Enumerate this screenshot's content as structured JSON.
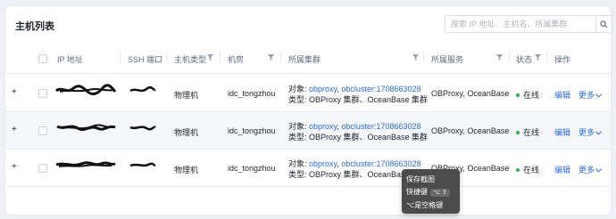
{
  "header": {
    "title": "主机列表",
    "search_placeholder": "搜索 IP 地址、主机名、所属集群"
  },
  "columns": {
    "ip": "IP 地址",
    "ssh": "SSH 端口",
    "host_type": "主机类型",
    "room": "机房",
    "cluster": "所属集群",
    "service": "所属服务",
    "status": "状态",
    "actions": "操作"
  },
  "rows": [
    {
      "expand": "+",
      "host_type": "物理机",
      "room": "idc_tongzhou",
      "cluster_obj_label": "对象:",
      "cluster_obj_1": "obproxy",
      "cluster_obj_sep": ",",
      "cluster_obj_2": "obcluster:1708663028",
      "cluster_type": "类型: OBProxy 集群、OceanBase 集群",
      "service": "OBProxy, OceanBase",
      "status": "在线",
      "edit": "编辑",
      "more": "更多"
    },
    {
      "expand": "+",
      "host_type": "物理机",
      "room": "idc_tongzhou",
      "cluster_obj_label": "对象:",
      "cluster_obj_1": "obproxy",
      "cluster_obj_sep": ",",
      "cluster_obj_2": "obcluster:1708663028",
      "cluster_type": "类型: OBProxy 集群、OceanBase 集群",
      "service": "OBProxy, OceanBase",
      "status": "在线",
      "edit": "编辑",
      "more": "更多"
    },
    {
      "expand": "+",
      "host_type": "物理机",
      "room": "idc_tongzhou",
      "cluster_obj_label": "对象:",
      "cluster_obj_1": "obproxy",
      "cluster_obj_sep": ",",
      "cluster_obj_2": "obcluster:1708663028",
      "cluster_type": "类型: OBProxy 集群、OceanBase 集群",
      "service": "OBProxy, OceanBase",
      "status": "在线",
      "edit": "编辑",
      "more": "更多"
    }
  ],
  "context_menu": {
    "save": "保存截图",
    "shortcut": "快捷键",
    "shortcut_key": "⌥ ⇧",
    "space_key": "⌥是空格键"
  },
  "colors": {
    "link": "#2b6be0",
    "online": "#2fb344",
    "row_alt": "#f5f7fb"
  },
  "icons": [
    "search-icon",
    "filter-icon",
    "chevron-down-icon",
    "expand-icon"
  ]
}
